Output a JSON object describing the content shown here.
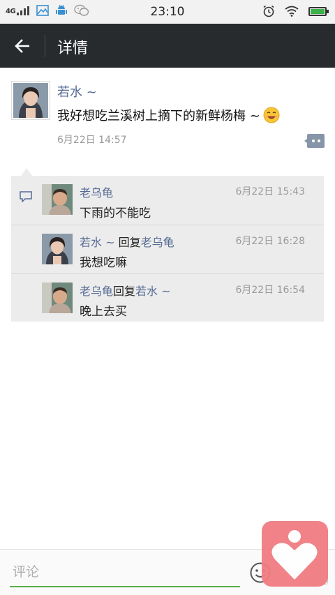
{
  "status_bar": {
    "network": "4G",
    "time": "23:10"
  },
  "header": {
    "title": "详情"
  },
  "post": {
    "author": "若水 ~",
    "text": "我好想吃兰溪树上摘下的新鲜杨梅 ~",
    "emoji": "smiling-face-icon",
    "time": "6月22日 14:57"
  },
  "comments": [
    {
      "author": "老乌龟",
      "reply_word": "",
      "reply_to": "",
      "time": "6月22日 15:43",
      "text": "下雨的不能吃"
    },
    {
      "author": "若水 ~",
      "reply_word": "回复",
      "reply_to": "老乌龟",
      "time": "6月22日 16:28",
      "text": "我想吃嘛"
    },
    {
      "author": "老乌龟",
      "reply_word": "回复",
      "reply_to": "若水 ~",
      "time": "6月22日 16:54",
      "text": "晚上去买"
    }
  ],
  "input": {
    "placeholder": "评论",
    "value": ""
  },
  "colors": {
    "titlebar": "#272b2e",
    "name_link": "#576b95",
    "comment_bg": "#ececec",
    "input_underline": "#58b146",
    "heart_widget": "#f07c82"
  }
}
